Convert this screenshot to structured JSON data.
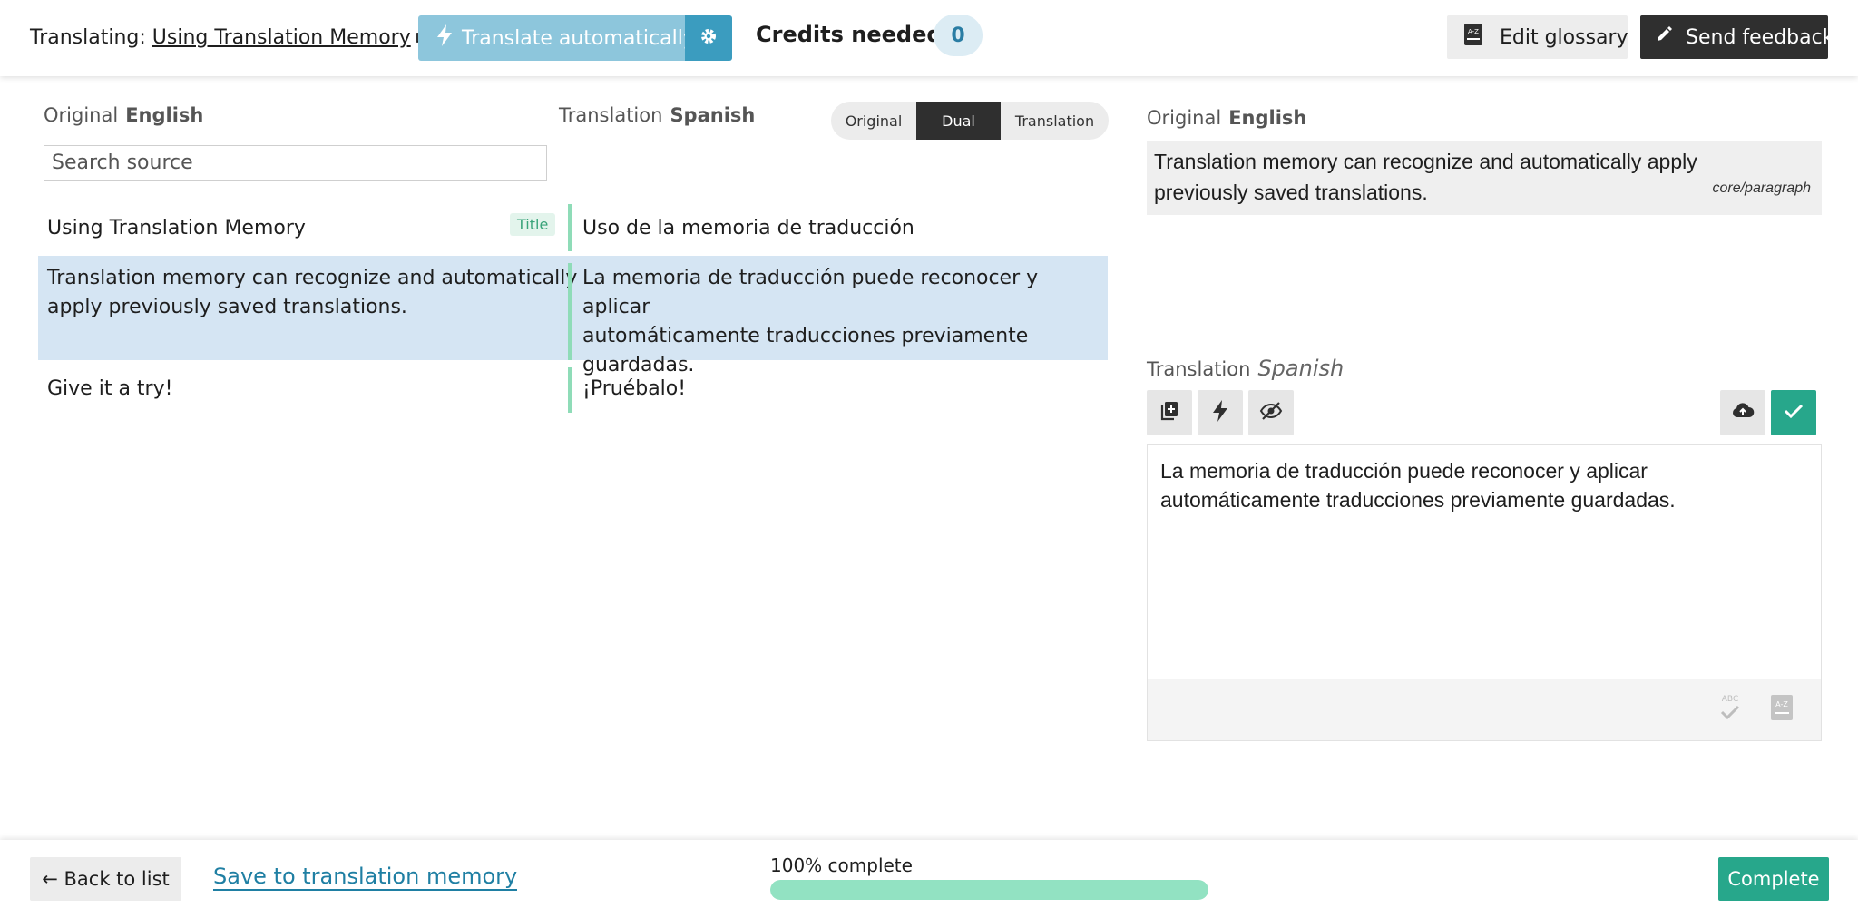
{
  "header": {
    "translating_label": "Translating:",
    "document_title": "Using Translation Memory",
    "translate_button_label": "Translate automatically",
    "credits_label": "Credits needed",
    "credits_value": "0",
    "edit_glossary_label": "Edit glossary",
    "send_feedback_label": "Send feedback"
  },
  "list": {
    "original_label": "Original",
    "original_language": "English",
    "translation_label": "Translation",
    "translation_language": "Spanish",
    "search_placeholder": "Search source",
    "view_modes": [
      "Original",
      "Dual",
      "Translation"
    ],
    "active_view": "Dual",
    "rows": [
      {
        "source": "Using Translation Memory",
        "badge": "Title",
        "target": "Uso de la memoria de traducción"
      },
      {
        "source_lines": [
          "Translation memory can recognize and automatically",
          "apply previously saved translations."
        ],
        "target_lines": [
          "La memoria de traducción puede reconocer y aplicar",
          "automáticamente traducciones previamente",
          "guardadas."
        ]
      },
      {
        "source": "Give it a try!",
        "target": "¡Pruébalo!"
      }
    ]
  },
  "editor": {
    "original_label": "Original",
    "original_language": "English",
    "original_lines": [
      "Translation memory can recognize and automatically apply",
      "previously saved translations."
    ],
    "block_type": "core/paragraph",
    "translation_label": "Translation",
    "translation_language": "Spanish",
    "translation_lines": [
      "La memoria de traducción puede reconocer y aplicar",
      "automáticamente traducciones previamente guardadas."
    ]
  },
  "footer": {
    "back_label": "← Back to list",
    "save_memory_label": "Save to translation memory",
    "progress_label": "100% complete",
    "progress_percent": 100,
    "complete_label": "Complete"
  },
  "colors": {
    "accent_green": "#27a78b",
    "accent_blue": "#3b9cbf",
    "selected_row": "#d5e5f3",
    "progress_fill": "#92e2c2"
  }
}
